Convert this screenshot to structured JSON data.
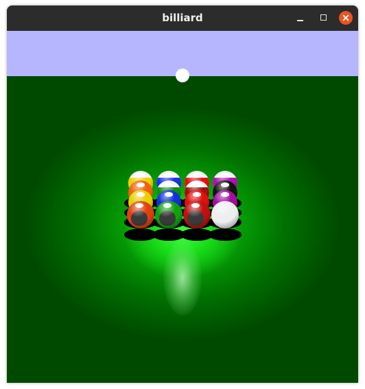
{
  "window": {
    "title": "billiard"
  },
  "colors": {
    "titlebar": "#2c2c2c",
    "close_button": "#e95420",
    "sky": "#b6b6ff",
    "felt_dark": "#003a00",
    "felt_bright": "#1fef1f",
    "lamp": "#ffffff"
  },
  "icons": [
    "minimize-icon",
    "maximize-icon",
    "close-icon"
  ],
  "balls": [
    {
      "row": 0,
      "col": 0,
      "color": "#f0d000",
      "kind": "stripe"
    },
    {
      "row": 0,
      "col": 1,
      "color": "#1a33e6",
      "kind": "stripe"
    },
    {
      "row": 0,
      "col": 2,
      "color": "#e61010",
      "kind": "stripe"
    },
    {
      "row": 0,
      "col": 3,
      "color": "#b010b0",
      "kind": "stripe"
    },
    {
      "row": 1,
      "col": 0,
      "color": "#f06010",
      "kind": "solid"
    },
    {
      "row": 1,
      "col": 1,
      "color": "#109010",
      "kind": "stripe"
    },
    {
      "row": 1,
      "col": 2,
      "color": "#a01010",
      "kind": "stripe"
    },
    {
      "row": 1,
      "col": 3,
      "color": "#111111",
      "kind": "solid"
    },
    {
      "row": 2,
      "col": 0,
      "color": "#e8d000",
      "kind": "solid"
    },
    {
      "row": 2,
      "col": 1,
      "color": "#1030e0",
      "kind": "solid"
    },
    {
      "row": 2,
      "col": 2,
      "color": "#e01010",
      "kind": "solid"
    },
    {
      "row": 2,
      "col": 3,
      "color": "#a010a0",
      "kind": "solid"
    },
    {
      "row": 3,
      "col": 0,
      "color": "#e04010",
      "kind": "solid"
    },
    {
      "row": 3,
      "col": 1,
      "color": "#10a010",
      "kind": "solid"
    },
    {
      "row": 3,
      "col": 2,
      "color": "#c01010",
      "kind": "solid"
    },
    {
      "row": 3,
      "col": 3,
      "color": "#eeeeee",
      "kind": "cue"
    }
  ]
}
